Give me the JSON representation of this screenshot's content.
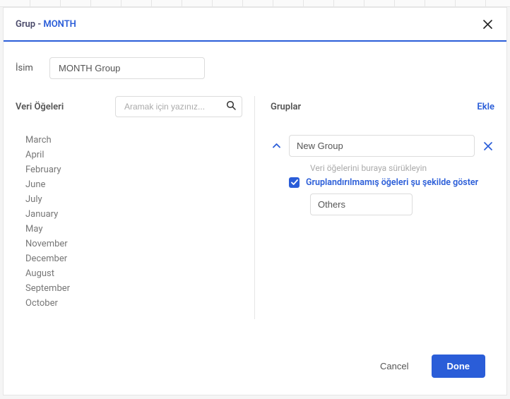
{
  "header": {
    "title_prefix": "Grup - ",
    "title_accent": "MONTH"
  },
  "name_row": {
    "label": "İsim",
    "value": "MONTH Group"
  },
  "left": {
    "title": "Veri Öğeleri",
    "search_placeholder": "Aramak için yazınız...",
    "items": [
      "March",
      "April",
      "February",
      "June",
      "July",
      "January",
      "May",
      "November",
      "December",
      "August",
      "September",
      "October"
    ]
  },
  "right": {
    "title": "Gruplar",
    "add_label": "Ekle",
    "group_name": "New Group",
    "drag_hint": "Veri öğelerini buraya sürükleyin",
    "ungrouped_label": "Gruplandırılmamış öğeleri şu şekilde göster",
    "ungrouped_checked": true,
    "others_value": "Others"
  },
  "footer": {
    "cancel": "Cancel",
    "done": "Done"
  }
}
